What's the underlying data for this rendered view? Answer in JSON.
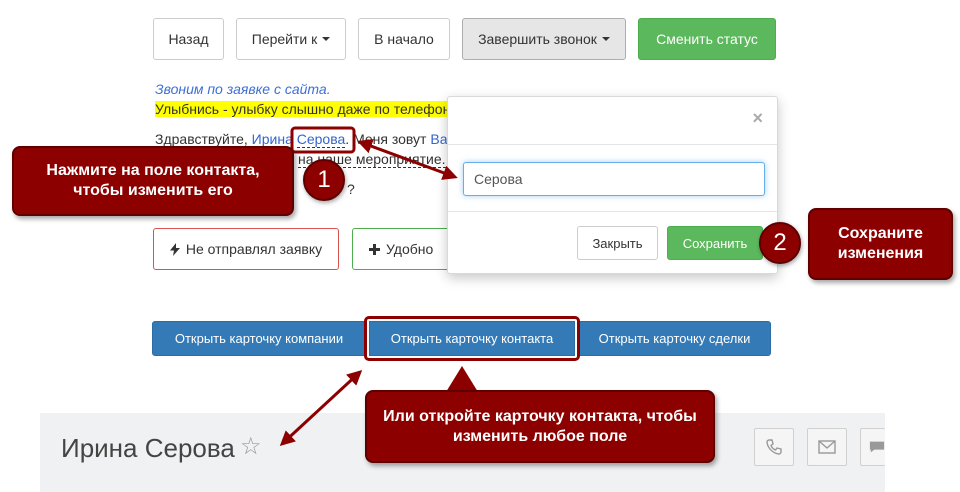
{
  "toolbar": {
    "back": "Назад",
    "goto": "Перейти к",
    "to_start": "В начало",
    "end_call": "Завершить звонок",
    "change_status": "Сменить статус"
  },
  "script": {
    "line1": "Звоним по заявке с сайта.",
    "line2": "Улыбнись - улыбку слышно даже по телефону",
    "line3_pre": "Здравствуйте, ",
    "first_name": "Ирина",
    "last_name": "Серова",
    "line3_mid": ". Меня зовут ",
    "agent_name": "Ва",
    "line4_part": "на наше мероприятие.",
    "line5_part": "?"
  },
  "answers": {
    "not_sent": "Не отправлял заявку",
    "convenient": "Удобно"
  },
  "popover": {
    "input_value": "Серова",
    "close_label": "Закрыть",
    "save_label": "Сохранить"
  },
  "cards": {
    "company": "Открыть карточку компании",
    "contact": "Открыть карточку контакта",
    "deal": "Открыть карточку сделки"
  },
  "contact_header": {
    "name": "Ирина Серова"
  },
  "callouts": {
    "c1": "Нажмите на поле контакта, чтобы изменить его",
    "n1": "1",
    "c2": "Сохраните изменения",
    "n2": "2",
    "c3": "Или откройте карточку контакта, чтобы изменить любое поле"
  },
  "colors": {
    "annotation": "#8c0000",
    "primary": "#337ab7",
    "success": "#5cb85c",
    "highlight": "#ffff00"
  }
}
